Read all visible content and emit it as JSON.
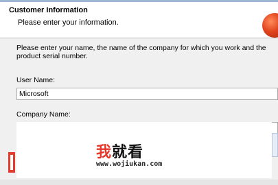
{
  "header": {
    "title": "Customer Information",
    "subtitle": "Please enter your information."
  },
  "form": {
    "instructions": "Please enter your name, the name of the company for which you work and the product serial number.",
    "user_name_label": "User Name:",
    "user_name_value": "Microsoft",
    "company_name_label": "Company Name:",
    "company_name_value": ""
  },
  "watermark": {
    "logo_accent": "我",
    "logo_rest": "就看",
    "url": "www.wojiukan.com"
  },
  "colors": {
    "accent_red": "#e23b2f",
    "header_bg": "#ffffff",
    "dialog_bg": "#f0f0f0"
  }
}
